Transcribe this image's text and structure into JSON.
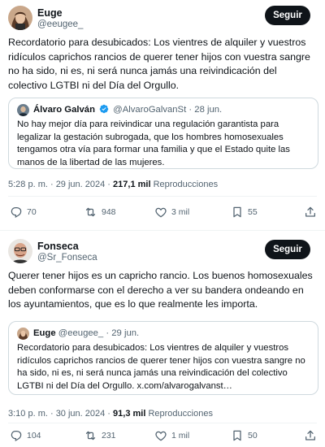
{
  "tweets": [
    {
      "author_name": "Euge",
      "author_handle": "@eeugee_",
      "follow_label": "Seguir",
      "text": "Recordatorio para desubicados: Los vientres de alquiler y vuestros ridículos caprichos rancios de querer tener hijos con vuestra sangre no ha sido, ni es, ni será nunca jamás una reivindicación del colectivo LGTBI ni del Día del Orgullo.",
      "quote": {
        "author_name": "Álvaro Galván",
        "author_handle": "@AlvaroGalvanSt",
        "date": "28 jun.",
        "text": "No hay mejor día para reivindicar una regulación garantista para legalizar la gestación subrogada, que los hombres homosexuales tengamos otra vía para formar una familia y que el Estado quite las manos de la libertad de las mujeres."
      },
      "timestamp": "5:28 p. m. · 29 jun. 2024 ·",
      "views": "217,1 mil",
      "views_label": "Reproducciones",
      "replies": "70",
      "reposts": "948",
      "likes": "3 mil",
      "bookmarks": "55"
    },
    {
      "author_name": "Fonseca",
      "author_handle": "@Sr_Fonseca",
      "follow_label": "Seguir",
      "text": "Querer tener hijos es un capricho rancio. Los buenos homosexuales deben conformarse con el derecho a ver su bandera ondeando en los ayuntamientos, que es lo que realmente les importa.",
      "quote": {
        "author_name": "Euge",
        "author_handle": "@eeugee_",
        "date": "29 jun.",
        "text": "Recordatorio para desubicados: Los vientres de alquiler y vuestros ridículos caprichos rancios de querer tener hijos con vuestra sangre no ha sido, ni es, ni será nunca jamás una reivindicación del colectivo LGTBI ni del Día del Orgullo. x.com/alvarogalvanst…"
      },
      "timestamp": "3:10 p. m. · 30 jun. 2024 ·",
      "views": "91,3 mil",
      "views_label": "Reproducciones",
      "replies": "104",
      "reposts": "231",
      "likes": "1 mil",
      "bookmarks": "50"
    }
  ],
  "colors": {
    "text": "#0f1419",
    "secondary": "#536471",
    "border": "#cfd9de",
    "verified": "#1d9bf0",
    "button": "#0f1419"
  }
}
